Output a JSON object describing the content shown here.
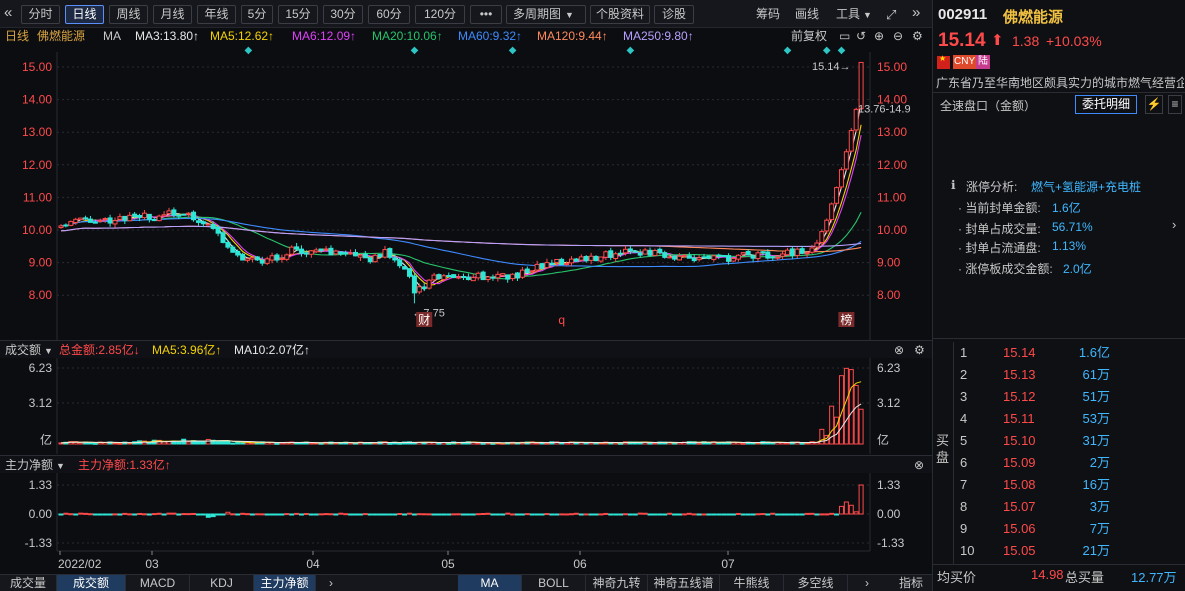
{
  "toolbar": {
    "periods": [
      "分时",
      "日线",
      "周线",
      "月线",
      "年线",
      "5分",
      "15分",
      "30分",
      "60分",
      "120分"
    ],
    "more": "•••",
    "multi": "多周期图",
    "stock_info": "个股资料",
    "diagnose": "诊股",
    "chips": "筹码",
    "draw": "画线",
    "tools": "工具",
    "nav_left": "«",
    "nav_right": "»"
  },
  "ma_line": {
    "period": "日线",
    "name": "佛燃能源",
    "ma_label": "MA",
    "ma3": "MA3:13.80↑",
    "ma5": "MA5:12.62↑",
    "ma6": "MA6:12.09↑",
    "ma20": "MA20:10.06↑",
    "ma60": "MA60:9.32↑",
    "ma120": "MA120:9.44↑",
    "ma250": "MA250:9.80↑",
    "restore": "前复权",
    "colors": {
      "ma3": "#e8e8e8",
      "ma5": "#f5d300",
      "ma6": "#e040fb",
      "ma20": "#27c46b",
      "ma60": "#3d8bff",
      "ma120": "#ff8a5c",
      "ma250": "#b8a0ff"
    }
  },
  "price_chart": {
    "ticks": [
      "15.00",
      "14.00",
      "13.00",
      "12.00",
      "11.00",
      "10.00",
      "9.00",
      "8.00"
    ],
    "high_label": "15.14",
    "high_arrow": "→",
    "range_label": "13.76-14.9",
    "low_label": "←7.75",
    "markers": [
      "财",
      "q",
      "榜"
    ]
  },
  "volume_panel": {
    "title": "成交额",
    "total": "总金额:2.85亿↓",
    "ma5": "MA5:3.96亿↑",
    "ma10": "MA10:2.07亿↑",
    "ticks": [
      "6.23",
      "3.12",
      "亿"
    ]
  },
  "flow_panel": {
    "title": "主力净额",
    "net": "主力净额:1.33亿↑",
    "ticks": [
      "1.33",
      "0.00",
      "-1.33"
    ]
  },
  "xaxis": [
    "2022/02",
    "03",
    "04",
    "05",
    "06",
    "07"
  ],
  "bottom_tabs": [
    "成交量",
    "成交额",
    "MACD",
    "KDJ",
    "主力净额"
  ],
  "bottom_tabs_right": [
    "MA",
    "BOLL",
    "神奇九转",
    "神奇五线谱",
    "牛熊线",
    "多空线"
  ],
  "bottom_more": "›",
  "bottom_last": "指标",
  "quote": {
    "code": "002911",
    "name": "佛燃能源",
    "price": "15.14",
    "change": "1.38",
    "pct": "+10.03%",
    "tags": [
      "CNY",
      "陆"
    ],
    "desc": "广东省乃至华南地区颇具实力的城市燃气经营企",
    "orderbook_label": "全速盘口（金额）",
    "detail_btn": "委托明细",
    "limit_title": "涨停分析:",
    "limit_reason": "燃气+氢能源+充电桩",
    "limit_items": [
      {
        "label": "当前封单金额:",
        "value": "1.6亿"
      },
      {
        "label": "封单占成交量:",
        "value": "56.71%"
      },
      {
        "label": "封单占流通盘:",
        "value": "1.13%"
      },
      {
        "label": "涨停板成交金额:",
        "value": "2.0亿"
      }
    ],
    "bid_label": "买盘",
    "bids": [
      {
        "n": "1",
        "price": "15.14",
        "amt": "1.6亿"
      },
      {
        "n": "2",
        "price": "15.13",
        "amt": "61万"
      },
      {
        "n": "3",
        "price": "15.12",
        "amt": "51万"
      },
      {
        "n": "4",
        "price": "15.11",
        "amt": "53万"
      },
      {
        "n": "5",
        "price": "15.10",
        "amt": "31万"
      },
      {
        "n": "6",
        "price": "15.09",
        "amt": "2万"
      },
      {
        "n": "7",
        "price": "15.08",
        "amt": "16万"
      },
      {
        "n": "8",
        "price": "15.07",
        "amt": "3万"
      },
      {
        "n": "9",
        "price": "15.06",
        "amt": "7万"
      },
      {
        "n": "10",
        "price": "15.05",
        "amt": "21万"
      }
    ],
    "avg_buy_label": "均买价",
    "avg_buy": "14.98",
    "total_buy_label": "总买量",
    "total_buy": "12.77万"
  }
}
